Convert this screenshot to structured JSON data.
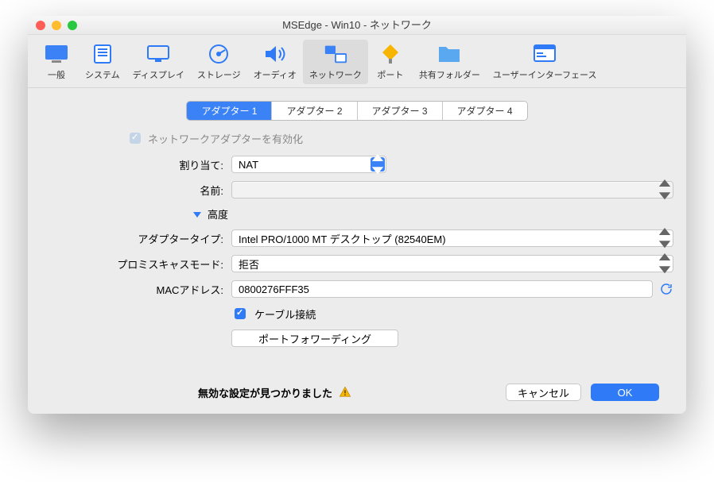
{
  "title": "MSEdge - Win10 - ネットワーク",
  "toolbar": [
    {
      "id": "general",
      "label": "一般"
    },
    {
      "id": "system",
      "label": "システム"
    },
    {
      "id": "display",
      "label": "ディスプレイ"
    },
    {
      "id": "storage",
      "label": "ストレージ"
    },
    {
      "id": "audio",
      "label": "オーディオ"
    },
    {
      "id": "network",
      "label": "ネットワーク",
      "active": true
    },
    {
      "id": "ports",
      "label": "ポート"
    },
    {
      "id": "shared",
      "label": "共有フォルダー"
    },
    {
      "id": "ui",
      "label": "ユーザーインターフェース"
    }
  ],
  "tabs": [
    "アダプター 1",
    "アダプター 2",
    "アダプター 3",
    "アダプター 4"
  ],
  "active_tab": 0,
  "labels": {
    "enable_adapter": "ネットワークアダプターを有効化",
    "attached": "割り当て:",
    "name": "名前:",
    "advanced": "高度",
    "adapter_type": "アダプタータイプ:",
    "promisc": "プロミスキャスモード:",
    "mac": "MACアドレス:",
    "cable": "ケーブル接続",
    "port_forward": "ポートフォワーディング",
    "invalid": "無効な設定が見つかりました",
    "cancel": "キャンセル",
    "ok": "OK"
  },
  "values": {
    "enable_adapter": true,
    "attached": "NAT",
    "name": "",
    "adapter_type": "Intel PRO/1000 MT デスクトップ (82540EM)",
    "promisc": "拒否",
    "mac": "0800276FFF35",
    "cable": true
  }
}
